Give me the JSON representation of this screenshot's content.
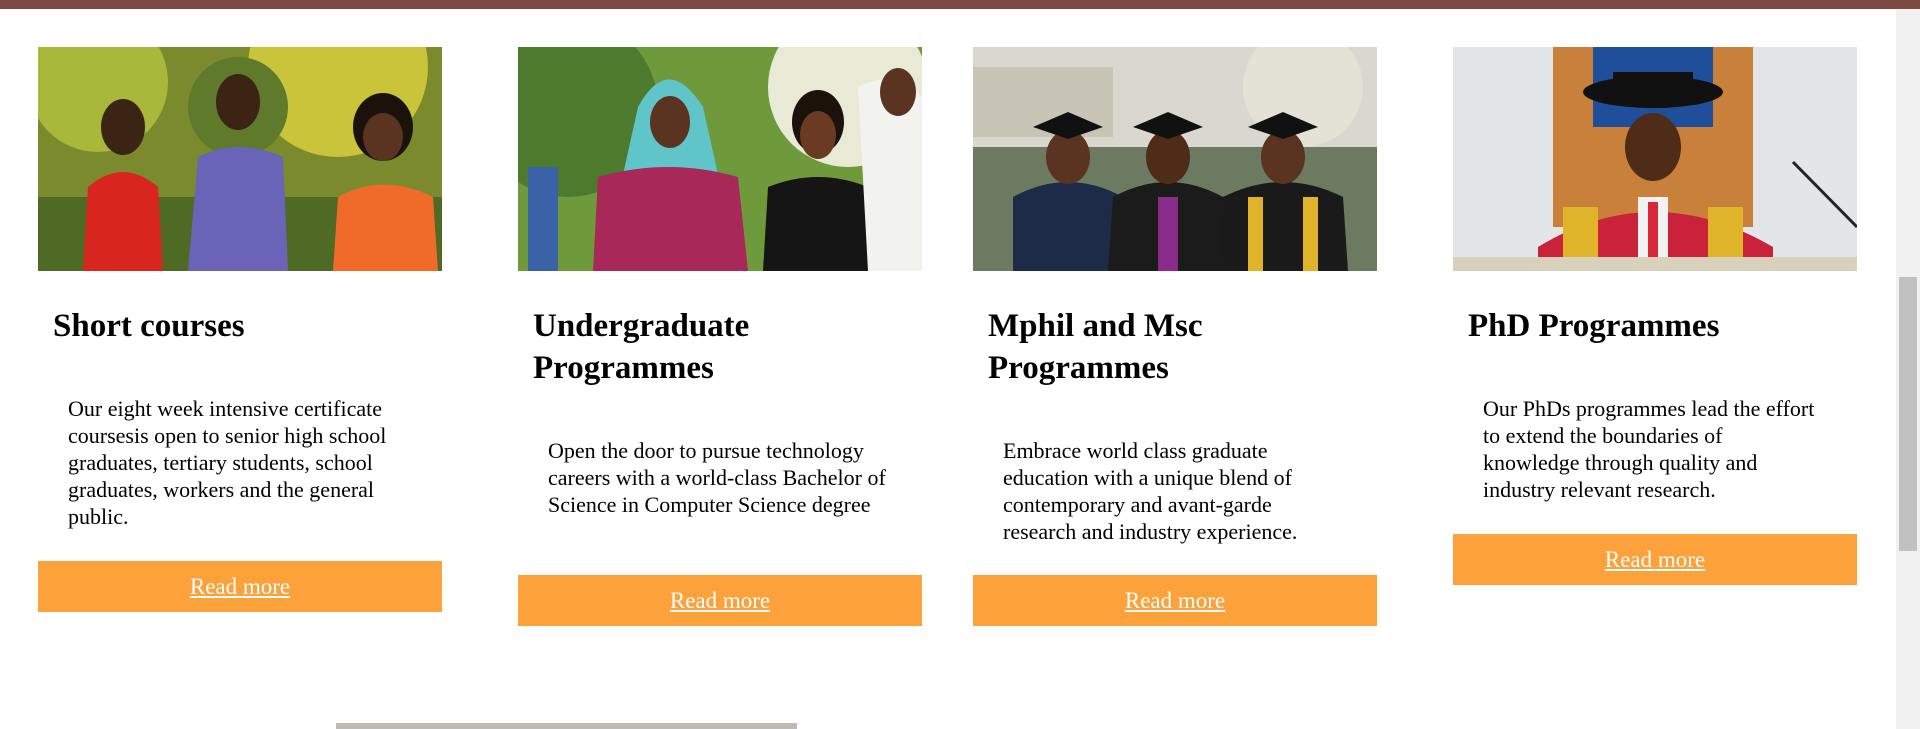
{
  "cards": [
    {
      "title": "Short courses",
      "description": "Our eight week intensive certificate coursesis open to senior high school graduates, tertiary students, school graduates, workers and the general public.",
      "button": "Read more"
    },
    {
      "title": "Undergraduate Programmes",
      "description": "Open the door to pursue technology careers with a world-class Bachelor of Science in Computer Science degree",
      "button": "Read more"
    },
    {
      "title": "Mphil and Msc Programmes",
      "description": "Embrace world class graduate education with a unique blend of contemporary and avant-garde research and industry experience.",
      "button": "Read more"
    },
    {
      "title": "PhD Programmes",
      "description": "Our PhDs programmes lead the effort to extend the boundaries of knowledge through quality and industry relevant research.",
      "button": "Read more"
    }
  ],
  "colors": {
    "accent": "#fda23b",
    "top_bar": "#7a4a43"
  }
}
